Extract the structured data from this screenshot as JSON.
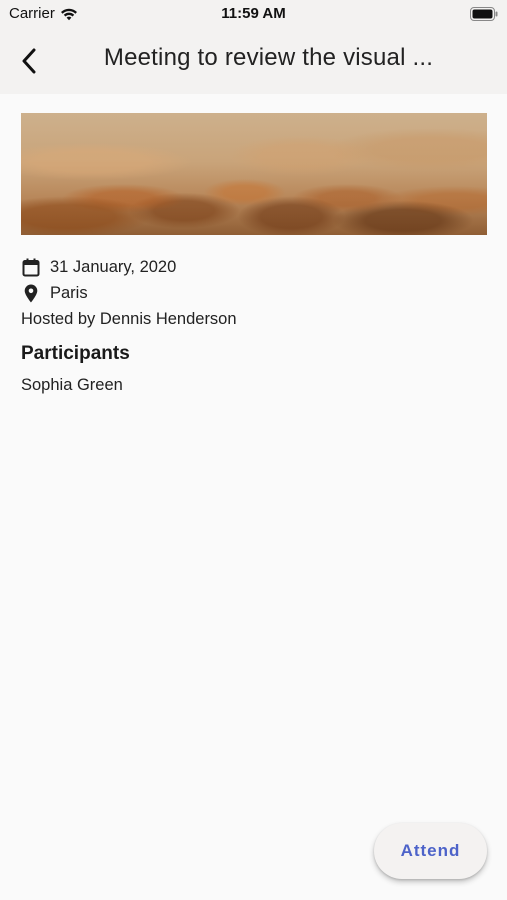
{
  "status_bar": {
    "carrier": "Carrier",
    "time": "11:59 AM"
  },
  "nav": {
    "title": "Meeting to review the visual ..."
  },
  "event": {
    "date": "31 January, 2020",
    "location": "Paris",
    "hosted_by": "Hosted by Dennis Henderson",
    "participants_heading": "Participants",
    "participants": [
      "Sophia Green"
    ]
  },
  "actions": {
    "attend_label": "Attend"
  },
  "colors": {
    "accent": "#4d63c9",
    "background": "#fafafa",
    "bar": "#f3f2f1"
  },
  "icons": {
    "date": "calendar-icon",
    "location": "location-pin-icon",
    "back": "chevron-left-icon",
    "wifi": "wifi-icon",
    "battery": "battery-icon"
  }
}
